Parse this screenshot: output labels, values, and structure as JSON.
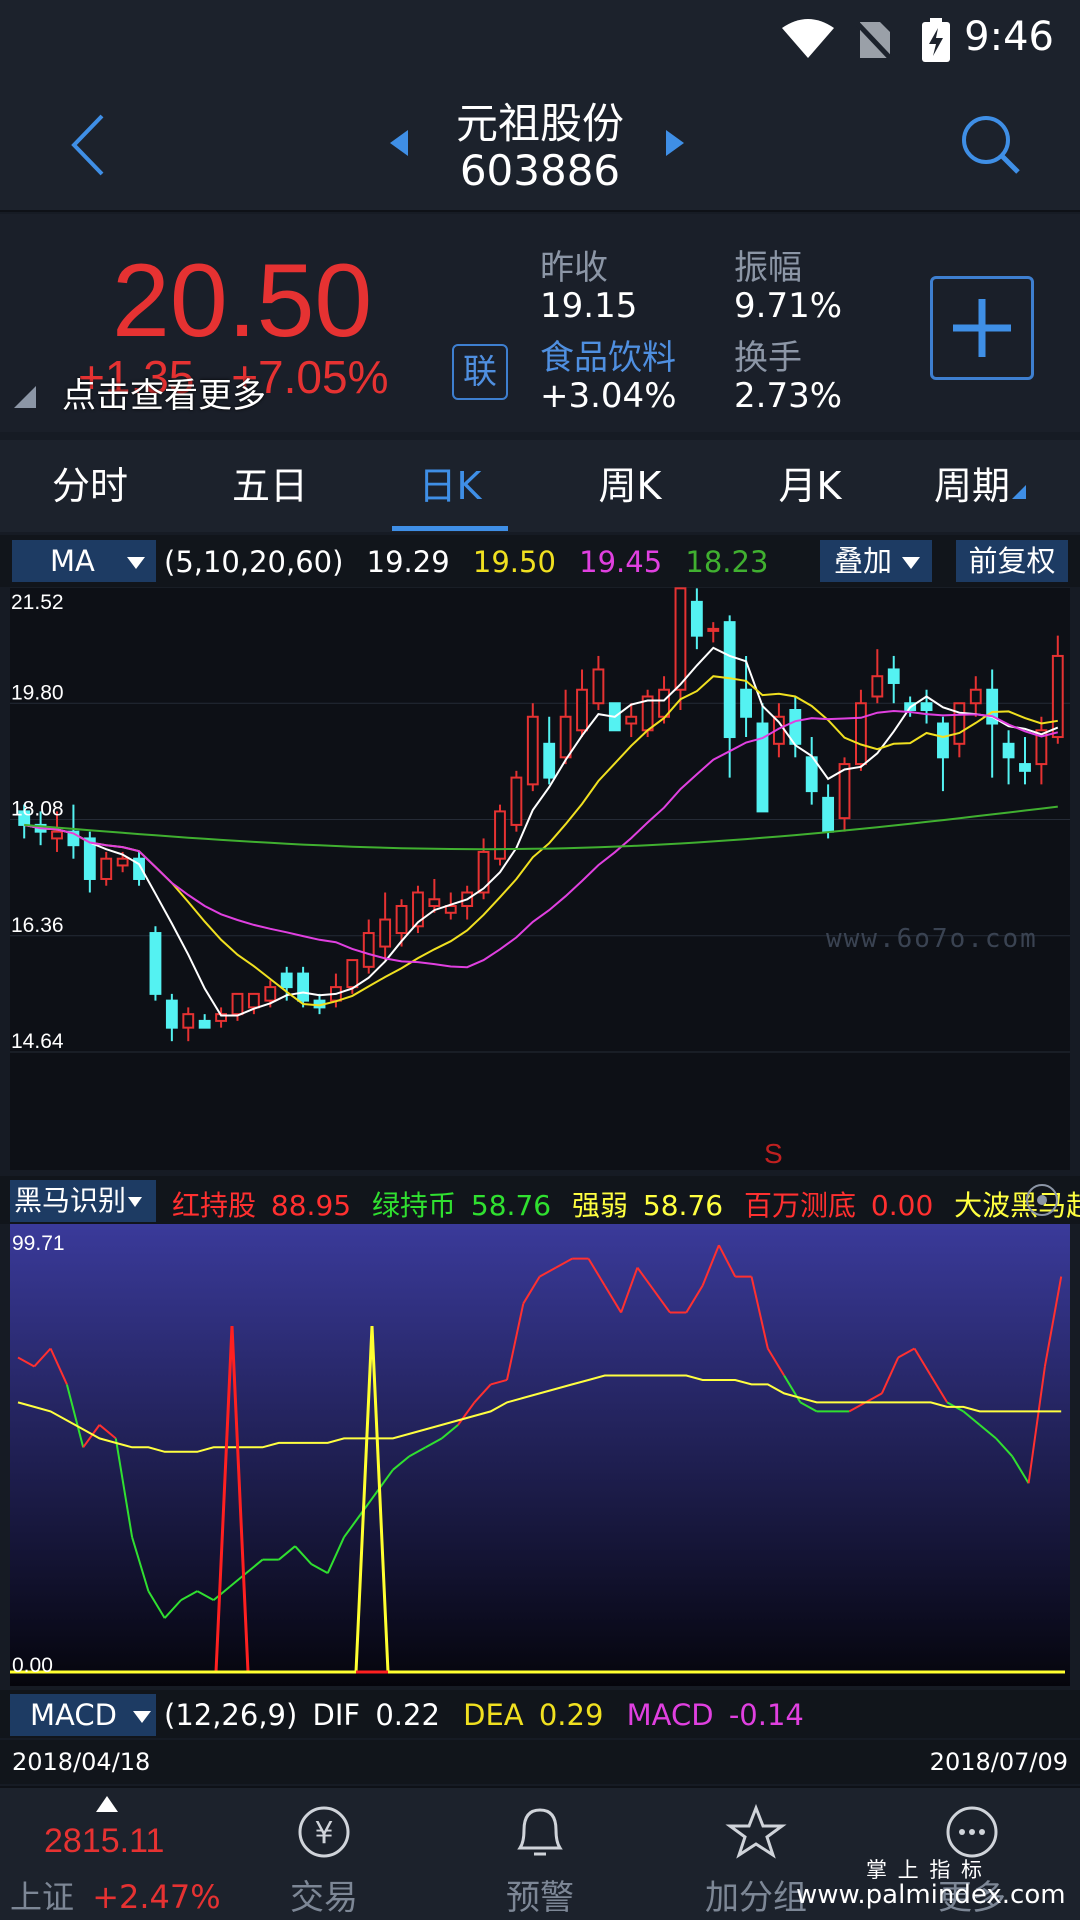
{
  "status_bar": {
    "time": "9:46"
  },
  "header": {
    "stock_name": "元祖股份",
    "stock_code": "603886"
  },
  "quote": {
    "price": "20.50",
    "change": "+1.35",
    "change_pct": "+7.05%",
    "more_hint": "点击查看更多",
    "link_label": "联",
    "prev_close_label": "昨收",
    "prev_close": "19.15",
    "amplitude_label": "振幅",
    "amplitude": "9.71%",
    "sector_label": "食品饮料",
    "sector_change": "+3.04%",
    "turnover_label": "换手",
    "turnover": "2.73%"
  },
  "tabs": [
    "分时",
    "五日",
    "日K",
    "周K",
    "月K",
    "周期"
  ],
  "active_tab": "日K",
  "ma_bar": {
    "indicator": "MA",
    "params": "(5,10,20,60)",
    "ma5": "19.29",
    "ma10": "19.50",
    "ma20": "19.45",
    "ma60": "18.23",
    "overlay": "叠加",
    "adjust": "前复权"
  },
  "chart_data": [
    {
      "type": "candlestick",
      "y_ticks": [
        "21.52",
        "19.80",
        "18.08",
        "16.36",
        "14.64"
      ],
      "ylim": [
        14.64,
        21.52
      ],
      "annotation": "S",
      "watermark": "www.6o7o.com",
      "series": [
        {
          "name": "MA5",
          "color": "#ffffff"
        },
        {
          "name": "MA10",
          "color": "#f0e020"
        },
        {
          "name": "MA20",
          "color": "#e040e0"
        },
        {
          "name": "MA60",
          "color": "#40b030"
        }
      ],
      "candles": [
        [
          18.2,
          18.0,
          18.3,
          17.8
        ],
        [
          18.0,
          17.9,
          18.2,
          17.7
        ],
        [
          17.8,
          17.9,
          18.2,
          17.6
        ],
        [
          17.9,
          17.7,
          18.3,
          17.5
        ],
        [
          17.8,
          17.2,
          17.9,
          17.0
        ],
        [
          17.2,
          17.5,
          17.6,
          17.1
        ],
        [
          17.4,
          17.5,
          17.6,
          17.3
        ],
        [
          17.5,
          17.2,
          17.6,
          17.1
        ],
        [
          16.4,
          15.5,
          16.5,
          15.4
        ],
        [
          15.4,
          15.0,
          15.5,
          14.8
        ],
        [
          15.0,
          15.2,
          15.3,
          14.8
        ],
        [
          15.1,
          15.0,
          15.2,
          15.0
        ],
        [
          15.1,
          15.2,
          15.3,
          15.0
        ],
        [
          15.2,
          15.5,
          15.5,
          15.1
        ],
        [
          15.3,
          15.5,
          15.5,
          15.2
        ],
        [
          15.4,
          15.6,
          15.7,
          15.3
        ],
        [
          15.8,
          15.6,
          15.9,
          15.4
        ],
        [
          15.8,
          15.4,
          15.9,
          15.3
        ],
        [
          15.4,
          15.3,
          15.5,
          15.2
        ],
        [
          15.4,
          15.6,
          15.8,
          15.3
        ],
        [
          15.6,
          16.0,
          16.0,
          15.5
        ],
        [
          15.9,
          16.4,
          16.6,
          15.8
        ],
        [
          16.2,
          16.6,
          17.0,
          16.0
        ],
        [
          16.4,
          16.8,
          16.9,
          16.2
        ],
        [
          16.5,
          17.0,
          17.1,
          16.4
        ],
        [
          16.8,
          16.9,
          17.2,
          16.7
        ],
        [
          16.7,
          16.8,
          17.0,
          16.6
        ],
        [
          16.8,
          17.0,
          17.1,
          16.6
        ],
        [
          17.0,
          17.6,
          17.8,
          16.9
        ],
        [
          17.5,
          18.2,
          18.3,
          17.4
        ],
        [
          18.0,
          18.7,
          18.8,
          17.9
        ],
        [
          18.6,
          19.6,
          19.8,
          18.5
        ],
        [
          19.2,
          18.7,
          19.6,
          18.6
        ],
        [
          19.0,
          19.6,
          20.0,
          18.9
        ],
        [
          19.4,
          20.0,
          20.3,
          19.3
        ],
        [
          19.8,
          20.3,
          20.5,
          19.7
        ],
        [
          19.8,
          19.4,
          19.8,
          19.4
        ],
        [
          19.5,
          19.6,
          19.8,
          19.3
        ],
        [
          19.4,
          19.9,
          20.0,
          19.3
        ],
        [
          19.6,
          20.0,
          20.2,
          19.5
        ],
        [
          20.0,
          21.5,
          21.5,
          19.7
        ],
        [
          21.3,
          20.8,
          21.5,
          20.6
        ],
        [
          20.9,
          20.9,
          21.0,
          20.7
        ],
        [
          21.0,
          19.3,
          21.1,
          18.7
        ],
        [
          20.0,
          19.6,
          20.5,
          19.3
        ],
        [
          19.5,
          18.2,
          19.8,
          18.2
        ],
        [
          19.2,
          19.6,
          19.8,
          19.0
        ],
        [
          19.7,
          19.2,
          19.9,
          19.0
        ],
        [
          19.0,
          18.5,
          19.3,
          18.3
        ],
        [
          18.4,
          17.9,
          18.6,
          17.8
        ],
        [
          18.1,
          18.9,
          19.0,
          17.9
        ],
        [
          18.9,
          19.8,
          20.0,
          18.8
        ],
        [
          19.9,
          20.2,
          20.6,
          19.8
        ],
        [
          20.3,
          20.1,
          20.5,
          19.8
        ],
        [
          19.8,
          19.7,
          19.9,
          19.6
        ],
        [
          19.8,
          19.7,
          20.0,
          19.5
        ],
        [
          19.5,
          19.0,
          19.6,
          18.5
        ],
        [
          19.2,
          19.8,
          19.8,
          19.0
        ],
        [
          19.8,
          20.0,
          20.2,
          19.6
        ],
        [
          20.0,
          19.5,
          20.3,
          18.7
        ],
        [
          19.2,
          19.0,
          19.4,
          18.6
        ],
        [
          18.9,
          18.8,
          19.3,
          18.6
        ],
        [
          18.9,
          19.4,
          19.6,
          18.6
        ],
        [
          19.3,
          20.5,
          20.8,
          19.2
        ]
      ]
    },
    {
      "type": "line",
      "title": "黑马识别",
      "y_ticks": [
        "99.71",
        "0.00"
      ],
      "ylim": [
        0,
        99.71
      ],
      "series": [
        {
          "name": "红持股",
          "value": "88.95",
          "color": "#ff3030"
        },
        {
          "name": "绿持币",
          "value": "58.76",
          "color": "#30e030"
        },
        {
          "name": "强弱",
          "value": "58.76",
          "color": "#ffff40"
        },
        {
          "name": "百万测底",
          "value": "0.00",
          "color": "#ff3030"
        },
        {
          "name": "大波黑马起",
          "color": "#ffff40"
        }
      ]
    }
  ],
  "macd_bar": {
    "indicator": "MACD",
    "params": "(12,26,9)",
    "dif_label": "DIF",
    "dif": "0.22",
    "dea_label": "DEA",
    "dea": "0.29",
    "macd_label": "MACD",
    "macd": "-0.14"
  },
  "dates": {
    "start": "2018/04/18",
    "end": "2018/07/09"
  },
  "bottom_nav": {
    "index_value": "2815.11",
    "index_name": "上证",
    "index_change": "+2.47%",
    "items": [
      "交易",
      "预警",
      "加分组",
      "更多"
    ]
  },
  "watermark_bottom": {
    "brand": "掌 上 指 标",
    "url": "www.palmindex.com"
  }
}
